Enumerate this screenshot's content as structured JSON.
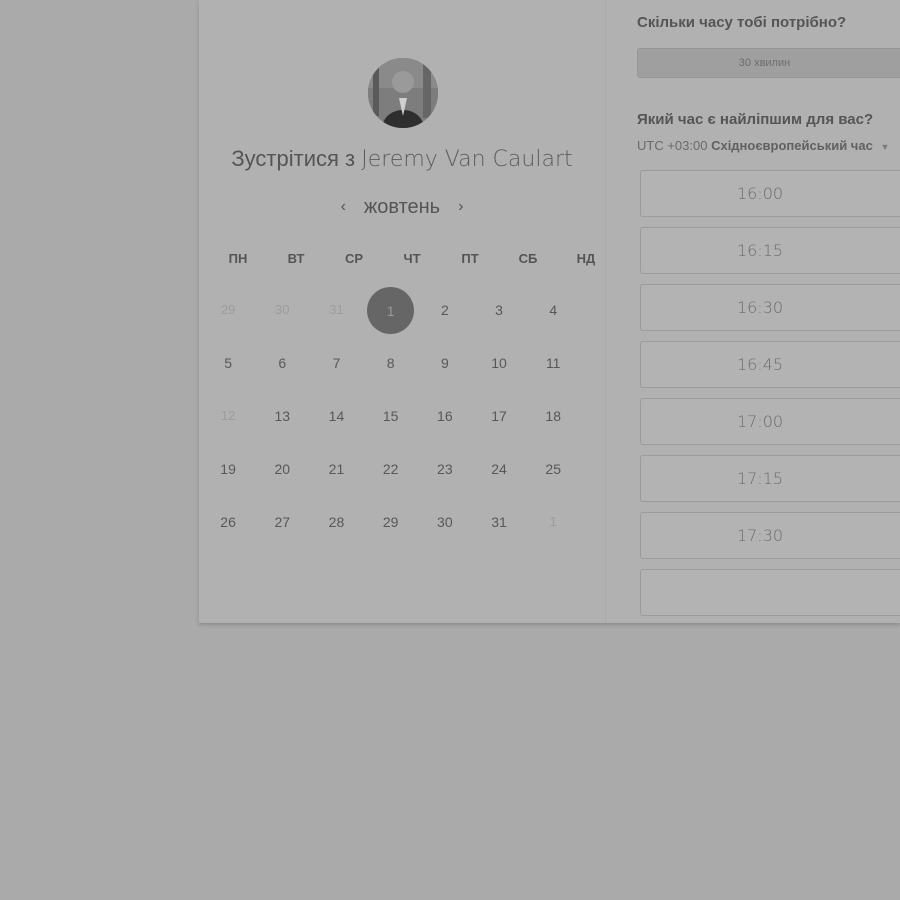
{
  "host": {
    "title_prefix": "Зустрітися з",
    "name": "Jeremy Van Caulart"
  },
  "calendar": {
    "month": "жовтень",
    "prev_icon": "‹",
    "next_icon": "›",
    "weekdays": [
      "ПН",
      "ВТ",
      "СР",
      "ЧТ",
      "ПТ",
      "СБ",
      "НД"
    ],
    "days": [
      {
        "d": "29",
        "dim": true
      },
      {
        "d": "30",
        "dim": true
      },
      {
        "d": "31",
        "dim": true
      },
      {
        "d": "1",
        "selected": true
      },
      {
        "d": "2"
      },
      {
        "d": "3"
      },
      {
        "d": "4"
      },
      {
        "d": "5"
      },
      {
        "d": "6"
      },
      {
        "d": "7"
      },
      {
        "d": "8"
      },
      {
        "d": "9"
      },
      {
        "d": "10"
      },
      {
        "d": "11"
      },
      {
        "d": "12",
        "dim": true
      },
      {
        "d": "13"
      },
      {
        "d": "14"
      },
      {
        "d": "15"
      },
      {
        "d": "16"
      },
      {
        "d": "17"
      },
      {
        "d": "18"
      },
      {
        "d": "19"
      },
      {
        "d": "20"
      },
      {
        "d": "21"
      },
      {
        "d": "22"
      },
      {
        "d": "23"
      },
      {
        "d": "24"
      },
      {
        "d": "25"
      },
      {
        "d": "26"
      },
      {
        "d": "27"
      },
      {
        "d": "28"
      },
      {
        "d": "29"
      },
      {
        "d": "30"
      },
      {
        "d": "31"
      },
      {
        "d": "1",
        "dim": true
      }
    ]
  },
  "duration": {
    "question": "Скільки часу тобі потрібно?",
    "selected": "30 хвилин"
  },
  "time": {
    "question": "Який час є найліпшим для вас?",
    "tz_offset": "UTC +03:00",
    "tz_name": "Східноєвропейський час",
    "slots": [
      "16:00",
      "16:15",
      "16:30",
      "16:45",
      "17:00",
      "17:15",
      "17:30",
      ""
    ]
  }
}
